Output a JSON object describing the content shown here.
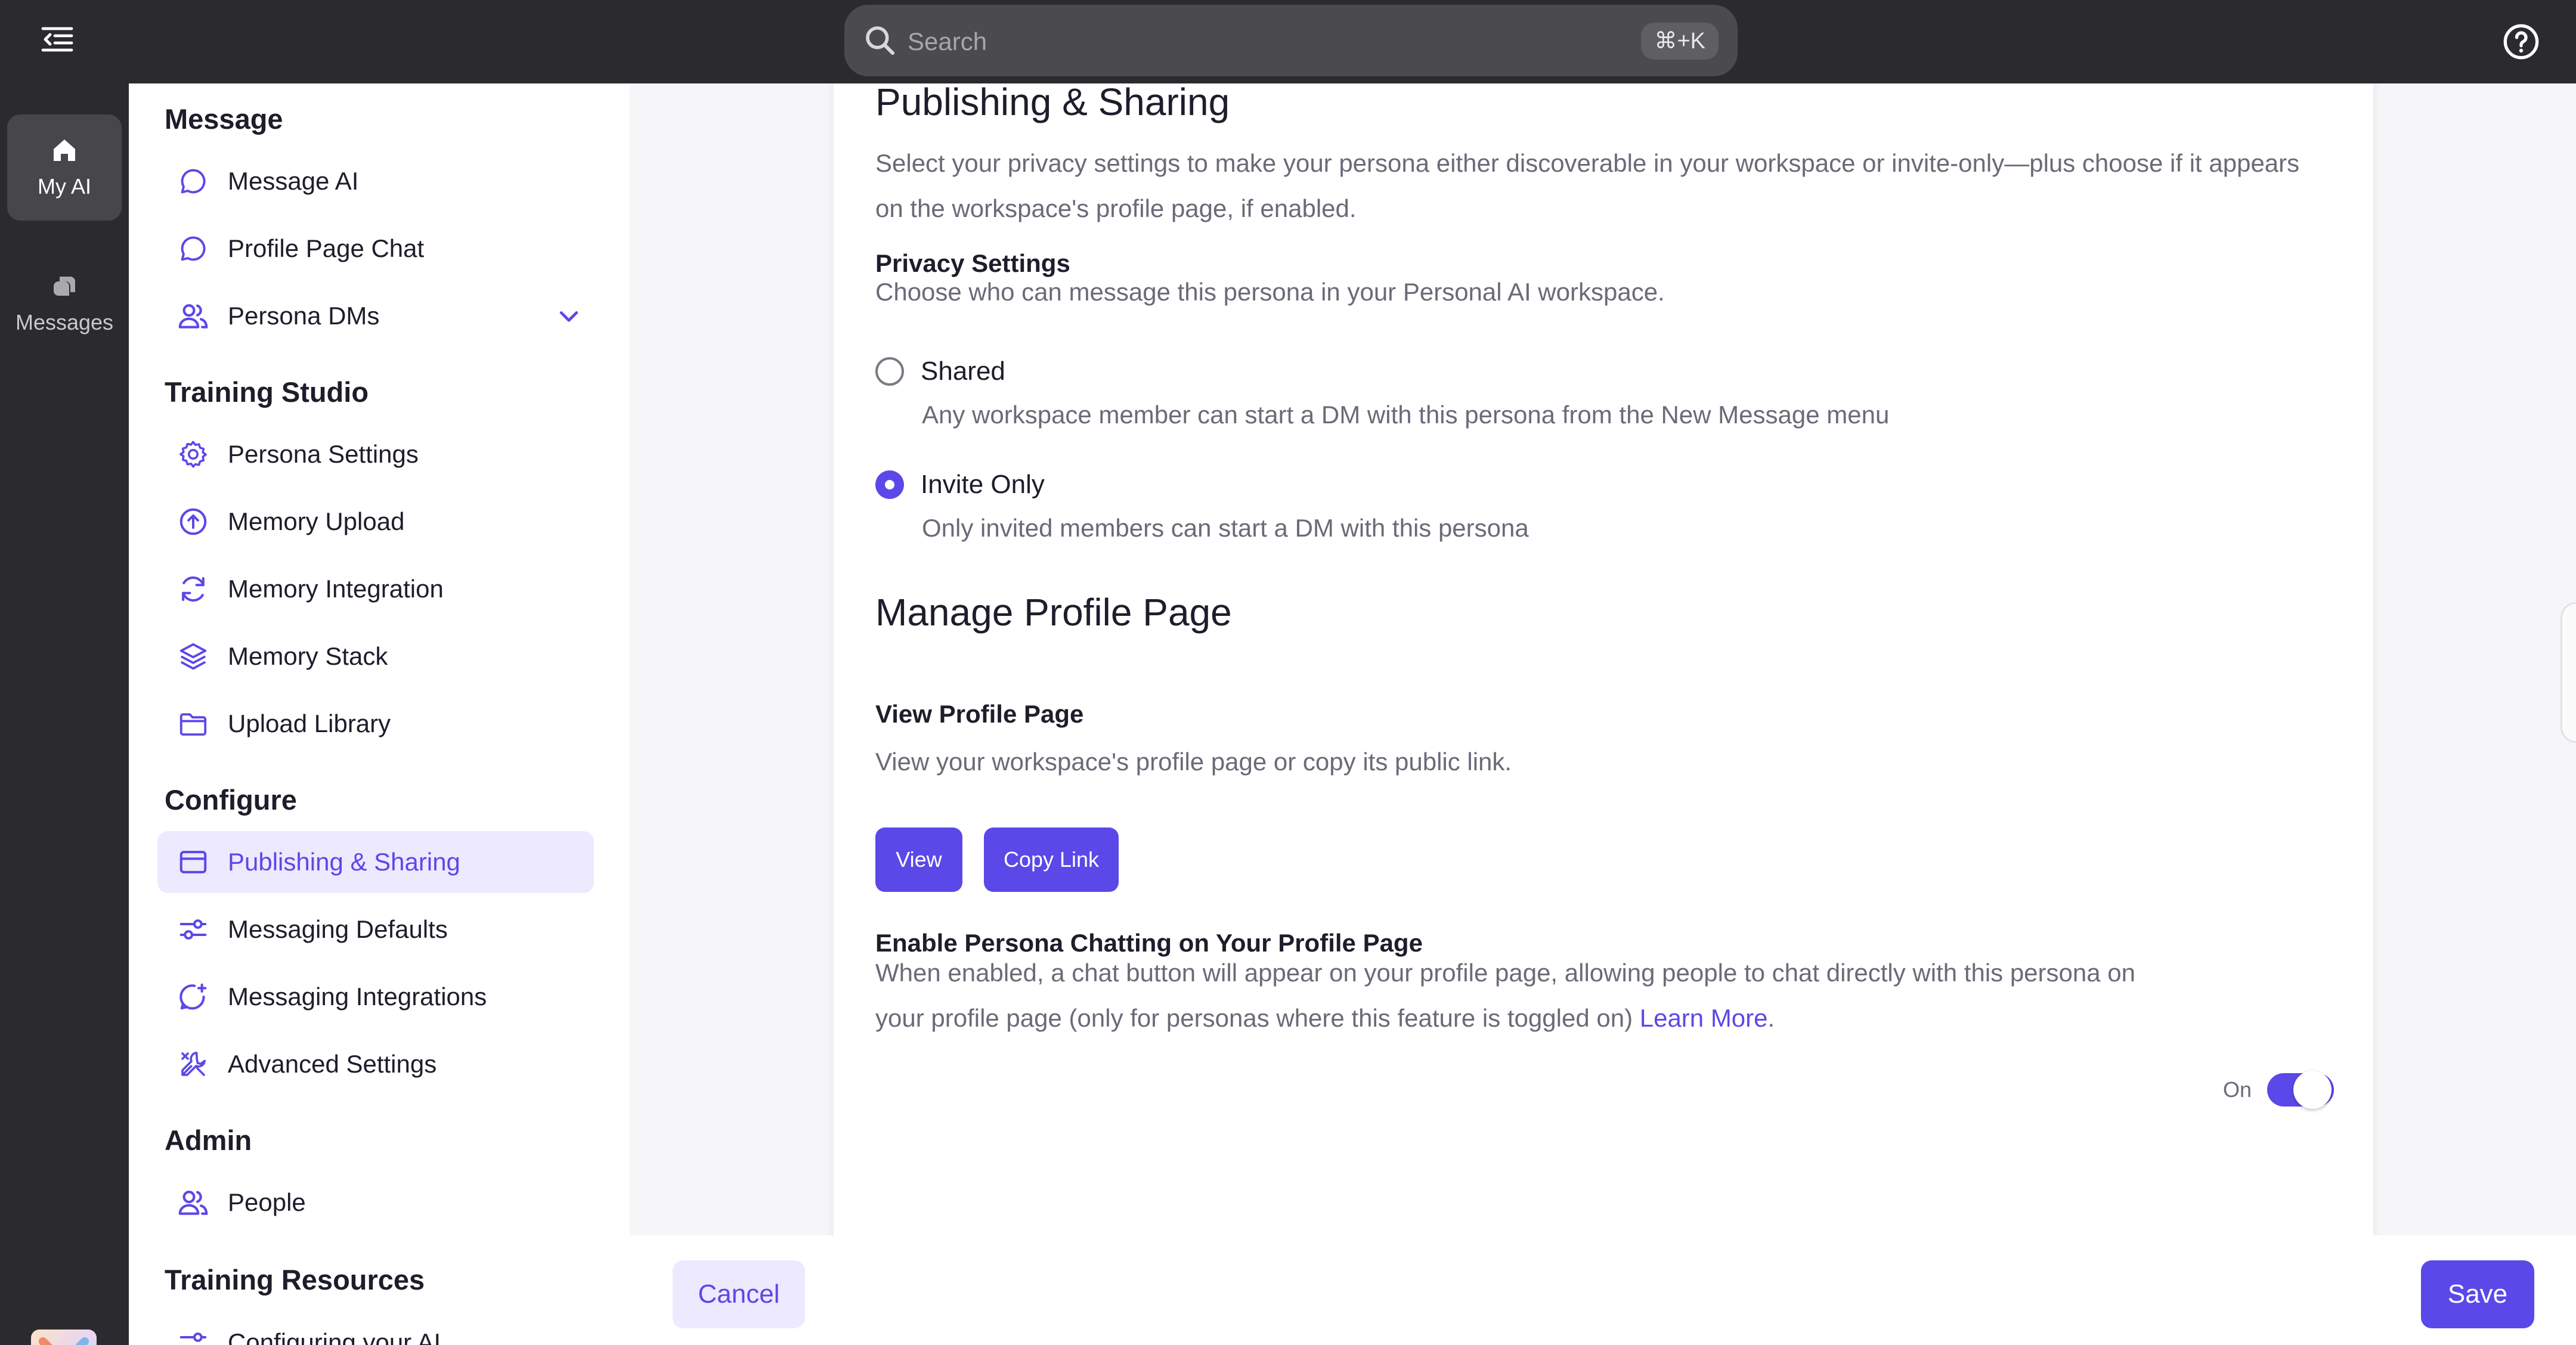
{
  "topbar": {
    "search_placeholder": "Search",
    "search_shortcut": "⌘+K"
  },
  "rail": {
    "items": [
      {
        "label": "My AI",
        "icon": "home-icon",
        "active": true
      },
      {
        "label": "Messages",
        "icon": "messages-icon",
        "active": false
      }
    ]
  },
  "sidebar": {
    "sections": [
      {
        "title": "Message",
        "items": [
          {
            "label": "Message AI",
            "icon": "chat-bubble-icon"
          },
          {
            "label": "Profile Page Chat",
            "icon": "chat-bubble-icon"
          },
          {
            "label": "Persona DMs",
            "icon": "people-icon",
            "expandable": true
          }
        ]
      },
      {
        "title": "Training Studio",
        "items": [
          {
            "label": "Persona Settings",
            "icon": "gear-icon"
          },
          {
            "label": "Memory Upload",
            "icon": "upload-circle-icon"
          },
          {
            "label": "Memory Integration",
            "icon": "sync-icon"
          },
          {
            "label": "Memory Stack",
            "icon": "layers-icon"
          },
          {
            "label": "Upload Library",
            "icon": "folder-icon"
          }
        ]
      },
      {
        "title": "Configure",
        "items": [
          {
            "label": "Publishing & Sharing",
            "icon": "browser-window-icon",
            "active": true
          },
          {
            "label": "Messaging Defaults",
            "icon": "sliders-icon"
          },
          {
            "label": "Messaging Integrations",
            "icon": "chat-plus-icon"
          },
          {
            "label": "Advanced Settings",
            "icon": "tools-icon"
          }
        ]
      },
      {
        "title": "Admin",
        "items": [
          {
            "label": "People",
            "icon": "people-icon"
          }
        ]
      },
      {
        "title": "Training Resources",
        "items": [
          {
            "label": "Configuring your AI",
            "icon": "sliders-icon"
          }
        ]
      }
    ]
  },
  "main": {
    "clipped_heading": "Publishing & Sharing",
    "intro": "Select your privacy settings to make your persona either discoverable in your workspace or invite-only—plus choose if it appears on the workspace's profile page, if enabled.",
    "privacy": {
      "title": "Privacy Settings",
      "description": "Choose who can message this persona in your Personal AI workspace.",
      "options": [
        {
          "label": "Shared",
          "description": "Any workspace member can start a DM with this persona from the New Message menu",
          "selected": false
        },
        {
          "label": "Invite Only",
          "description": "Only invited members can start a DM with this persona",
          "selected": true
        }
      ]
    },
    "profile_page": {
      "title": "Manage Profile Page",
      "view_title": "View Profile Page",
      "view_description": "View your workspace's profile page or copy its public link.",
      "view_button": "View",
      "copy_button": "Copy Link"
    },
    "chatting": {
      "title": "Enable Persona Chatting on Your Profile Page",
      "description": "When enabled, a chat button will appear on your profile page, allowing people to chat directly with this persona on your profile page (only for personas where this feature is toggled on)",
      "link": "Learn More",
      "link_suffix": ".",
      "toggle_label": "On",
      "toggle_on": true
    },
    "footer": {
      "cancel": "Cancel",
      "save": "Save"
    }
  },
  "colors": {
    "accent": "#5b48e8",
    "accent_light": "#ede9ff",
    "dark_chrome": "#2b2b2f"
  }
}
